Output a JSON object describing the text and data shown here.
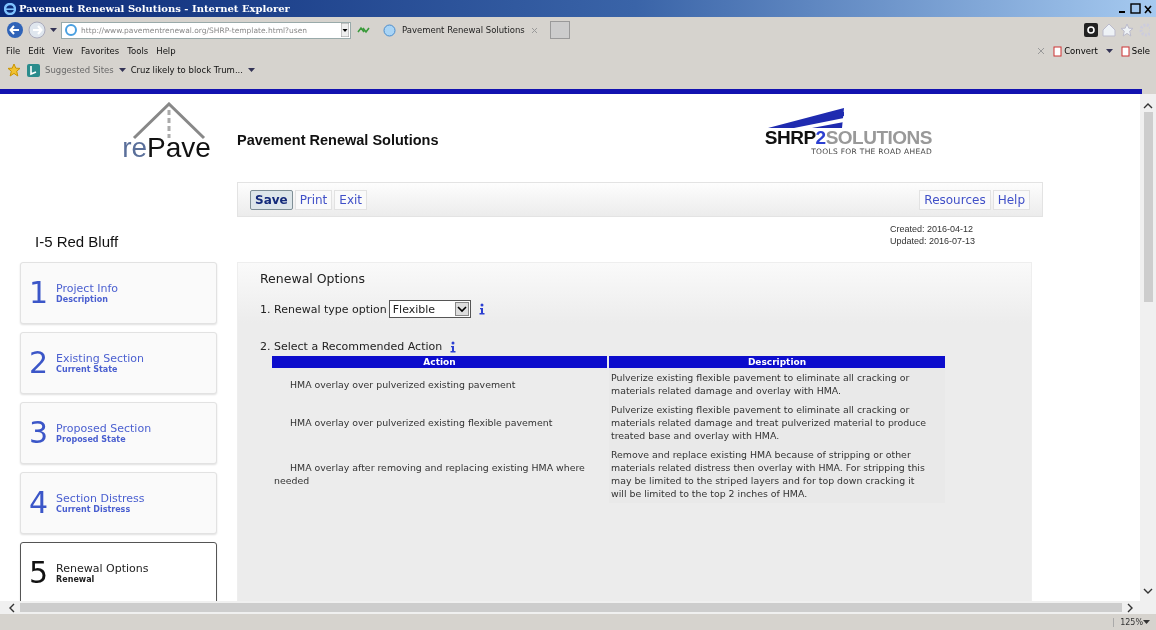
{
  "browser": {
    "title": "Pavement Renewal Solutions - Internet Explorer",
    "address": "http://www.pavementrenewal.org/SHRP-template.html?usen",
    "tab": "Pavement Renewal Solutions",
    "menu": [
      "File",
      "Edit",
      "View",
      "Favorites",
      "Tools",
      "Help"
    ],
    "favorites": [
      {
        "label": "Suggested Sites",
        "disabled": true
      },
      {
        "label": "Cruz likely to block Trum...",
        "disabled": false
      }
    ],
    "command_bar": [
      "Convert",
      "Sele"
    ],
    "zoom": "125%"
  },
  "page": {
    "logo": {
      "prefix": "re",
      "suffix": "Pave"
    },
    "title": "Pavement Renewal Solutions",
    "partner_logo": {
      "part_1": "SHRP",
      "part_2": "2",
      "part_3": "SOLUTIONS",
      "tagline": "TOOLS FOR THE ROAD AHEAD"
    },
    "toolbar_left": [
      {
        "label": "Save",
        "selected": true
      },
      {
        "label": "Print",
        "selected": false
      },
      {
        "label": "Exit",
        "selected": false
      }
    ],
    "toolbar_right": [
      {
        "label": "Resources",
        "selected": false
      },
      {
        "label": "Help",
        "selected": false
      }
    ],
    "project_name": "I-5 Red Bluff",
    "created": "Created: 2016-04-12",
    "updated": "Updated: 2016-07-13",
    "steps": [
      {
        "number": "1",
        "title": "Project Info",
        "subtitle": "Description",
        "selected": false
      },
      {
        "number": "2",
        "title": "Existing Section",
        "subtitle": "Current State",
        "selected": false
      },
      {
        "number": "3",
        "title": "Proposed Section",
        "subtitle": "Proposed State",
        "selected": false
      },
      {
        "number": "4",
        "title": "Section Distress",
        "subtitle": "Current Distress",
        "selected": false
      },
      {
        "number": "5",
        "title": "Renewal Options",
        "subtitle": "Renewal",
        "selected": true
      }
    ],
    "panel": {
      "heading": "Renewal Options",
      "type_label": "1. Renewal type option",
      "type_value": "Flexible",
      "action_label": "2. Select a Recommended Action",
      "table": {
        "columns": [
          "Action",
          "Description"
        ],
        "rows": [
          [
            "HMA overlay over pulverized existing pavement",
            "Pulverize existing flexible pavement to eliminate all cracking or materials related damage and overlay with HMA."
          ],
          [
            "HMA overlay over pulverized existing flexible pavement",
            "Pulverize existing flexible pavement to eliminate all cracking or materials related damage and treat pulverized material to produce treated base and overlay with HMA."
          ],
          [
            "HMA overlay after removing and replacing existing HMA where needed",
            "Remove and replace existing HMA because of stripping or other materials related distress then overlay with HMA. For stripping this may be limited to the striped layers and for top down cracking it will be limited to the top 2 inches of HMA."
          ]
        ]
      }
    }
  }
}
